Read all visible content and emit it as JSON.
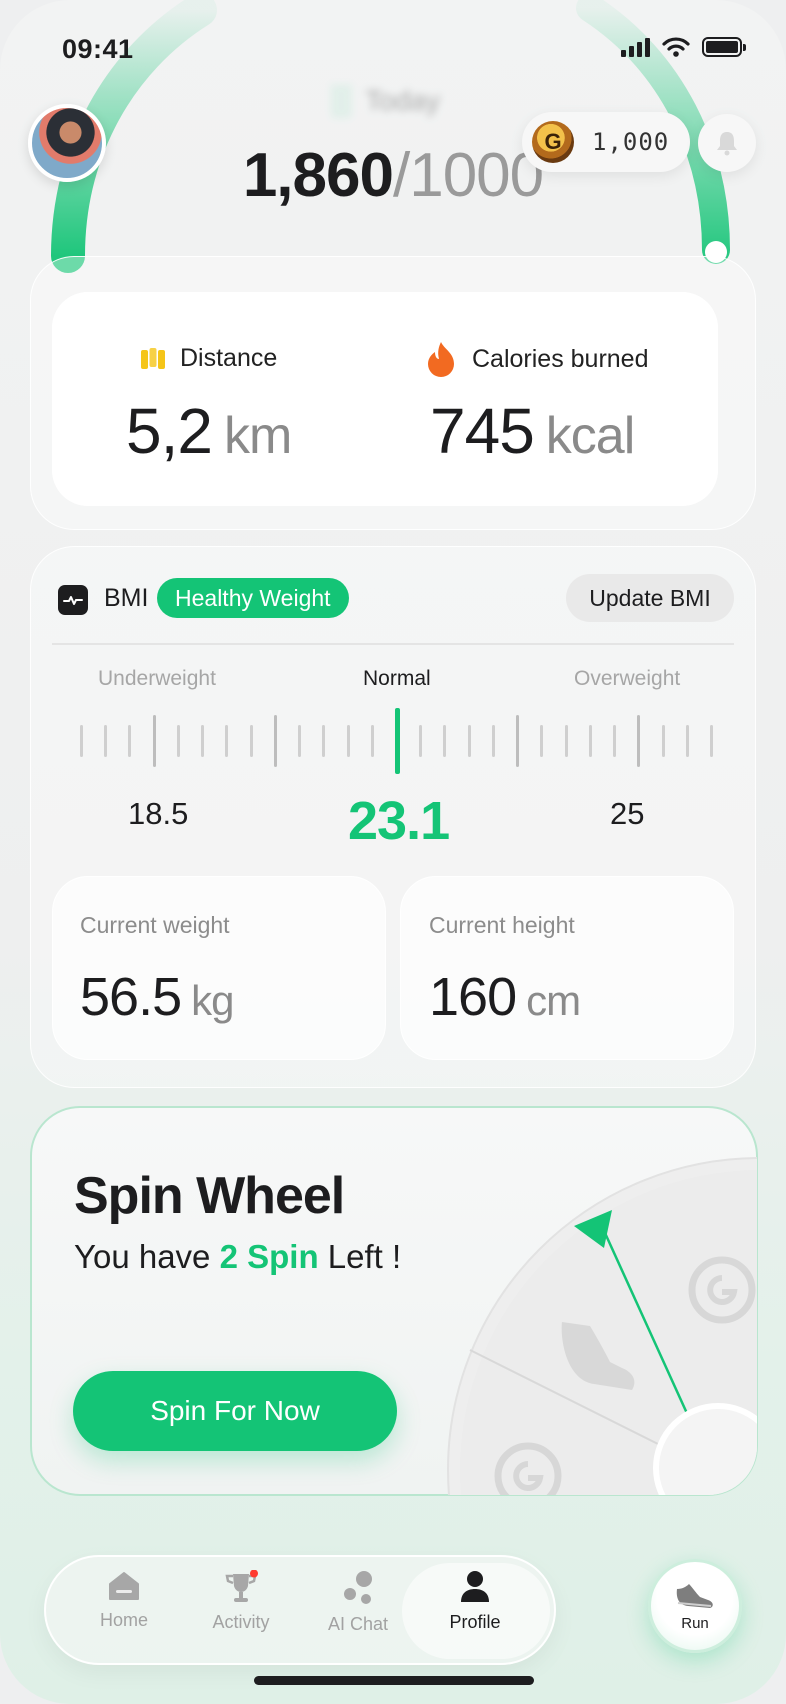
{
  "status_bar": {
    "time": "09:41"
  },
  "header": {
    "today_label": "Today",
    "steps_current": "1,860",
    "steps_separator": "/",
    "steps_goal": "1000",
    "coins": "1,000"
  },
  "summary": {
    "distance": {
      "label": "Distance",
      "value": "5,2",
      "unit": "km"
    },
    "calories": {
      "label": "Calories burned",
      "value": "745",
      "unit": "kcal"
    }
  },
  "bmi": {
    "title": "BMI",
    "badge": "Healthy Weight",
    "update_label": "Update BMI",
    "ranges": [
      "Underweight",
      "Normal",
      "Overweight"
    ],
    "low_bound": "18.5",
    "current": "23.1",
    "high_bound": "25",
    "weight": {
      "label": "Current weight",
      "value": "56.5",
      "unit": "kg"
    },
    "height": {
      "label": "Current height",
      "value": "160",
      "unit": "cm"
    }
  },
  "spin": {
    "title": "Spin Wheel",
    "sub_prefix": "You have ",
    "sub_highlight": "2 Spin",
    "sub_suffix": " Left !",
    "button_label": "Spin For Now"
  },
  "nav": {
    "items": [
      {
        "label": "Home",
        "icon": "home-icon",
        "active": false
      },
      {
        "label": "Activity",
        "icon": "trophy-icon",
        "active": false
      },
      {
        "label": "AI Chat",
        "icon": "chat-bubbles-icon",
        "active": false
      },
      {
        "label": "Profile",
        "icon": "person-icon",
        "active": true
      }
    ],
    "run_label": "Run"
  },
  "colors": {
    "accent": "#14c476",
    "text": "#1d1d1f",
    "muted": "#8a8a8a"
  }
}
